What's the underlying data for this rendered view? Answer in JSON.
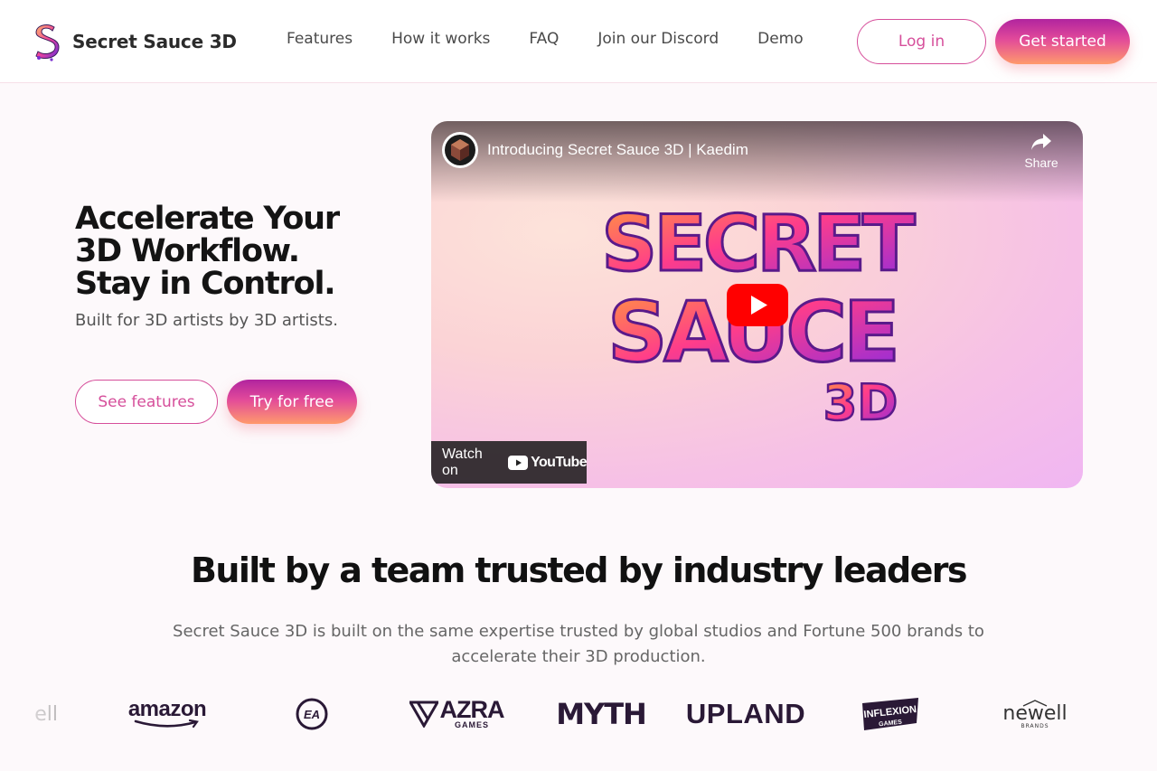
{
  "brand": {
    "name": "Secret Sauce 3D"
  },
  "nav": {
    "items": [
      {
        "label": "Features"
      },
      {
        "label": "How it works"
      },
      {
        "label": "FAQ"
      },
      {
        "label": "Join our Discord"
      },
      {
        "label": "Demo"
      }
    ]
  },
  "header": {
    "login_label": "Log in",
    "get_started_label": "Get started"
  },
  "hero": {
    "title": "Accelerate Your 3D Workflow. Stay in Control.",
    "subtitle": "Built for 3D artists by 3D artists.",
    "see_features_label": "See features",
    "try_free_label": "Try for free"
  },
  "video": {
    "title": "Introducing Secret Sauce 3D | Kaedim",
    "share_label": "Share",
    "watch_label": "Watch on",
    "youtube_word": "YouTube",
    "art_line1": "SECRET",
    "art_line2": "SAUCE",
    "art_line3": "3D"
  },
  "trusted": {
    "title": "Built by a team trusted by industry leaders",
    "description": "Secret Sauce 3D is built on the same expertise trusted by global studios and Fortune 500 brands to accelerate their 3D production.",
    "logos": {
      "newell_partial": "ell",
      "amazon": "amazon",
      "ea": "EA",
      "azra_main": "AZRA",
      "azra_sub": "GAMES",
      "myth": "MYTH",
      "upland": "UPLAND",
      "inflexion_main": "INFLEXION",
      "inflexion_sub": "GAMES",
      "newell": "newell",
      "newell_sub": "BRANDS"
    }
  },
  "colors": {
    "accent_pink": "#d64f9b",
    "gradient_start": "#b1249f",
    "gradient_end": "#ff9a6c",
    "youtube_red": "#ff0000"
  }
}
